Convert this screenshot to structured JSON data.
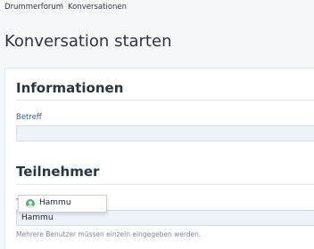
{
  "breadcrumb": {
    "items": [
      "Drummerforum",
      "Konversationen"
    ],
    "separator": "/"
  },
  "page": {
    "title": "Konversation starten"
  },
  "sections": {
    "informationen": "Informationen",
    "teilnehmer": "Teilnehmer"
  },
  "fields": {
    "betreff": {
      "label": "Betreff",
      "value": ""
    },
    "teilnehmer": {
      "label": "T",
      "value": "Hammu",
      "hint": "Mehrere Benutzer müssen einzeln eingegeben werden."
    }
  },
  "autocomplete": {
    "items": [
      {
        "name": "Hammu",
        "icon": "user-avatar-icon"
      }
    ]
  },
  "colors": {
    "label": "#2f5f93",
    "input_bg": "#eef3f9",
    "avatar": "#5fae7a"
  }
}
